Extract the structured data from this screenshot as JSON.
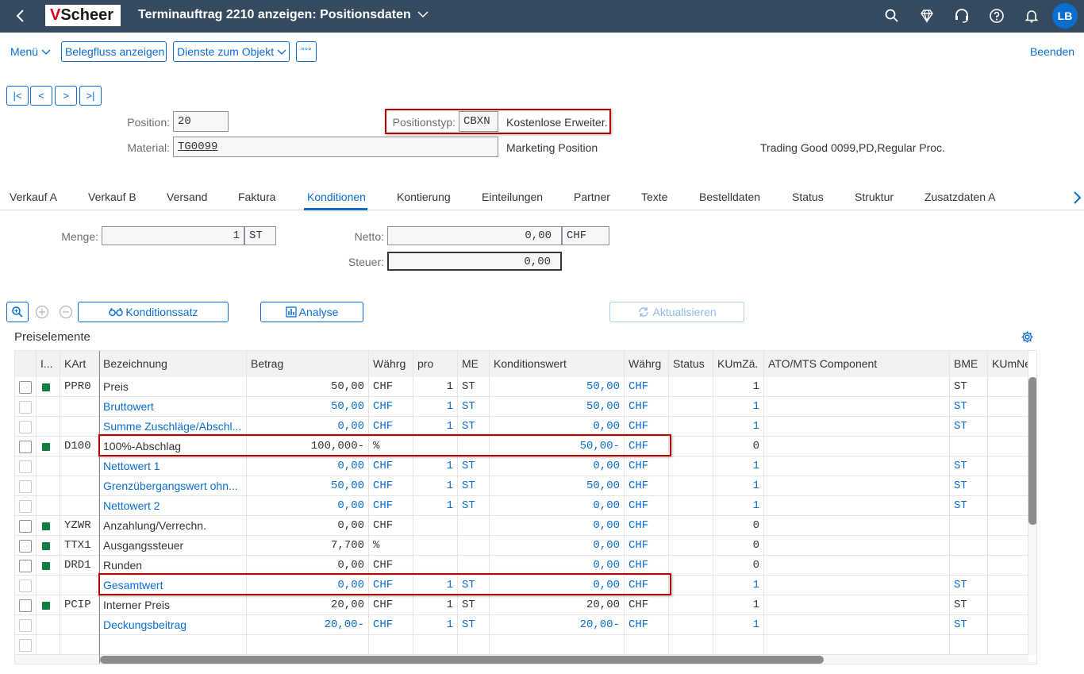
{
  "shell": {
    "logo_v": "V",
    "logo_text": "Scheer",
    "title": "Terminauftrag 2210 anzeigen: Positionsdaten",
    "avatar": "LB"
  },
  "toolbar": {
    "menu": "Menü",
    "belegfluss": "Belegfluss anzeigen",
    "dienste": "Dienste zum Objekt",
    "more": "°°°",
    "beenden": "Beenden"
  },
  "header": {
    "position_label": "Position:",
    "position_value": "20",
    "positionstyp_label": "Positionstyp:",
    "positionstyp_code": "CBXN",
    "positionstyp_text": "Kostenlose Erweiter.",
    "material_label": "Material:",
    "material_value": "TG0099",
    "material_desc": "Marketing Position",
    "material_desc2": "Trading Good 0099,PD,Regular Proc."
  },
  "tabs": [
    {
      "label": "Verkauf A"
    },
    {
      "label": "Verkauf B"
    },
    {
      "label": "Versand"
    },
    {
      "label": "Faktura"
    },
    {
      "label": "Konditionen"
    },
    {
      "label": "Kontierung"
    },
    {
      "label": "Einteilungen"
    },
    {
      "label": "Partner"
    },
    {
      "label": "Texte"
    },
    {
      "label": "Bestelldaten"
    },
    {
      "label": "Status"
    },
    {
      "label": "Struktur"
    },
    {
      "label": "Zusatzdaten A"
    }
  ],
  "amounts": {
    "menge_label": "Menge:",
    "menge_value": "1",
    "menge_unit": "ST",
    "netto_label": "Netto:",
    "netto_value": "0,00",
    "netto_curr": "CHF",
    "steuer_label": "Steuer:",
    "steuer_value": "0,00"
  },
  "actions": {
    "konditionssatz": "Konditionssatz",
    "analyse": "Analyse",
    "aktualisieren": "Aktualisieren"
  },
  "section_title": "Preiselemente",
  "columns": [
    "I...",
    "KArt",
    "Bezeichnung",
    "Betrag",
    "Währg",
    "pro",
    "ME",
    "Konditionswert",
    "Währg",
    "Status",
    "KUmZä.",
    "ATO/MTS Component",
    "BME",
    "KUmNe"
  ],
  "rows": [
    {
      "ind": true,
      "kart": "PPR0",
      "bez": "Preis",
      "betrag": "50,00",
      "waehrg": "CHF",
      "pro": "1",
      "me": "ST",
      "kwert": "50,00",
      "waehrg2": "CHF",
      "kumz": "1",
      "bme": "ST",
      "blue": false
    },
    {
      "ind": false,
      "kart": "",
      "bez": "Bruttowert",
      "betrag": "50,00",
      "waehrg": "CHF",
      "pro": "1",
      "me": "ST",
      "kwert": "50,00",
      "waehrg2": "CHF",
      "kumz": "1",
      "bme": "ST",
      "blue": true
    },
    {
      "ind": false,
      "kart": "",
      "bez": "Summe Zuschläge/Abschl...",
      "betrag": "0,00",
      "waehrg": "CHF",
      "pro": "1",
      "me": "ST",
      "kwert": "0,00",
      "waehrg2": "CHF",
      "kumz": "1",
      "bme": "ST",
      "blue": true
    },
    {
      "ind": true,
      "kart": "D100",
      "bez": "100%-Abschlag",
      "betrag": "100,000-",
      "waehrg": "%",
      "pro": "",
      "me": "",
      "kwert": "50,00-",
      "waehrg2": "CHF",
      "kumz": "0",
      "bme": "",
      "blue": false
    },
    {
      "ind": false,
      "kart": "",
      "bez": "Nettowert 1",
      "betrag": "0,00",
      "waehrg": "CHF",
      "pro": "1",
      "me": "ST",
      "kwert": "0,00",
      "waehrg2": "CHF",
      "kumz": "1",
      "bme": "ST",
      "blue": true
    },
    {
      "ind": false,
      "kart": "",
      "bez": "Grenzübergangswert ohn...",
      "betrag": "50,00",
      "waehrg": "CHF",
      "pro": "1",
      "me": "ST",
      "kwert": "50,00",
      "waehrg2": "CHF",
      "kumz": "1",
      "bme": "ST",
      "blue": true
    },
    {
      "ind": false,
      "kart": "",
      "bez": "Nettowert 2",
      "betrag": "0,00",
      "waehrg": "CHF",
      "pro": "1",
      "me": "ST",
      "kwert": "0,00",
      "waehrg2": "CHF",
      "kumz": "1",
      "bme": "ST",
      "blue": true
    },
    {
      "ind": true,
      "kart": "YZWR",
      "bez": "Anzahlung/Verrechn.",
      "betrag": "0,00",
      "waehrg": "CHF",
      "pro": "",
      "me": "",
      "kwert": "0,00",
      "waehrg2": "CHF",
      "kumz": "0",
      "bme": "",
      "blue": false
    },
    {
      "ind": true,
      "kart": "TTX1",
      "bez": "Ausgangssteuer",
      "betrag": "7,700",
      "waehrg": "%",
      "pro": "",
      "me": "",
      "kwert": "0,00",
      "waehrg2": "CHF",
      "kumz": "0",
      "bme": "",
      "blue": false
    },
    {
      "ind": true,
      "kart": "DRD1",
      "bez": "Runden",
      "betrag": "0,00",
      "waehrg": "CHF",
      "pro": "",
      "me": "",
      "kwert": "0,00",
      "waehrg2": "CHF",
      "kumz": "0",
      "bme": "",
      "blue": false
    },
    {
      "ind": false,
      "kart": "",
      "bez": "Gesamtwert",
      "betrag": "0,00",
      "waehrg": "CHF",
      "pro": "1",
      "me": "ST",
      "kwert": "0,00",
      "waehrg2": "CHF",
      "kumz": "1",
      "bme": "ST",
      "blue": true
    },
    {
      "ind": true,
      "kart": "PCIP",
      "bez": "Interner Preis",
      "betrag": "20,00",
      "waehrg": "CHF",
      "pro": "1",
      "me": "ST",
      "kwert": "20,00",
      "waehrg2": "CHF",
      "kumz": "1",
      "bme": "ST",
      "blue": false
    },
    {
      "ind": false,
      "kart": "",
      "bez": "Deckungsbeitrag",
      "betrag": "20,00-",
      "waehrg": "CHF",
      "pro": "1",
      "me": "ST",
      "kwert": "20,00-",
      "waehrg2": "CHF",
      "kumz": "1",
      "bme": "ST",
      "blue": true
    },
    {
      "ind": false,
      "kart": "",
      "bez": "",
      "betrag": "",
      "waehrg": "",
      "pro": "",
      "me": "",
      "kwert": "",
      "waehrg2": "",
      "kumz": "",
      "bme": "",
      "blue": false
    }
  ],
  "colors": {
    "shell": "#354a5f",
    "accent": "#0a6ed1",
    "highlight": "#bb0000",
    "indicator": "#107e3e"
  }
}
